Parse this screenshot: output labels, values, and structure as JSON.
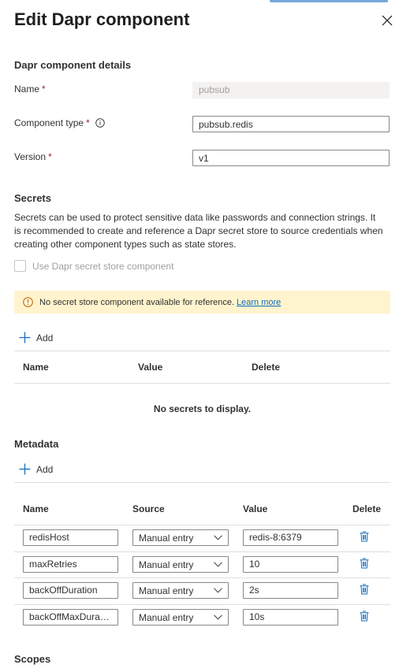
{
  "panel": {
    "title": "Edit Dapr component"
  },
  "details": {
    "heading": "Dapr component details",
    "name_label": "Name",
    "name_value": "pubsub",
    "type_label": "Component type",
    "type_value": "pubsub.redis",
    "version_label": "Version",
    "version_value": "v1",
    "required_mark": "*"
  },
  "secrets": {
    "heading": "Secrets",
    "description": "Secrets can be used to protect sensitive data like passwords and connection strings. It is recommended to create and reference a Dapr secret store to source credentials when creating other component types such as state stores.",
    "checkbox_label": "Use Dapr secret store component",
    "warning_text": "No secret store component available for reference.",
    "warning_link": "Learn more",
    "add_label": "Add",
    "columns": [
      "Name",
      "Value",
      "Delete"
    ],
    "empty_text": "No secrets to display."
  },
  "metadata": {
    "heading": "Metadata",
    "add_label": "Add",
    "columns": [
      "Name",
      "Source",
      "Value",
      "Delete"
    ],
    "rows": [
      {
        "name": "redisHost",
        "source": "Manual entry",
        "value": "redis-8:6379"
      },
      {
        "name": "maxRetries",
        "source": "Manual entry",
        "value": "10"
      },
      {
        "name": "backOffDuration",
        "source": "Manual entry",
        "value": "2s"
      },
      {
        "name": "backOffMaxDurati...",
        "source": "Manual entry",
        "value": "10s"
      }
    ]
  },
  "scopes": {
    "heading": "Scopes"
  },
  "colors": {
    "accent": "#0f6cbd",
    "warning_bg": "#fff4ce",
    "required": "#a4262c"
  },
  "icons": {
    "close": "close-icon",
    "info": "info-icon",
    "warning": "warning-icon",
    "add": "plus-icon",
    "delete": "trash-icon",
    "dropdown": "chevron-down-icon"
  }
}
